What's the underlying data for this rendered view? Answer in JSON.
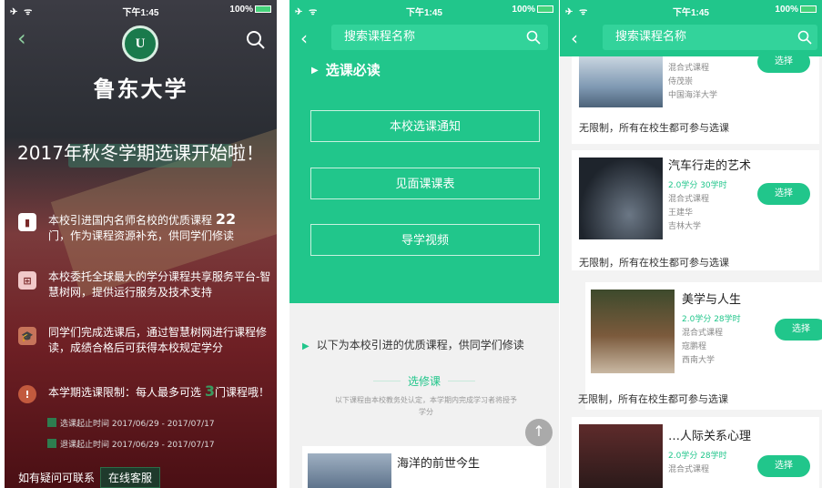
{
  "status": {
    "carrier": "✈ ᯤ",
    "time": "下午1:45",
    "battery": "100%"
  },
  "panel1": {
    "university": "鲁东大学",
    "logo_text": "U",
    "headline": "2017年秋冬学期选课开始啦！",
    "item1_text": "本校引进国内名师名校的优质课程",
    "item1_count": "22",
    "item1_text2": "门，作为课程资源补充，供同学们修读",
    "item2_text": "本校委托全球最大的学分课程共享服务平台-智慧树网，提供运行服务及技术支持",
    "item3_text": "同学们完成选课后，通过智慧树网进行课程修读，成绩合格后可获得本校规定学分",
    "item4_text": "本学期选课限制：每人最多可选",
    "item4_count": "3",
    "item4_text2": "门课程哦！",
    "date1": "选课起止时间 2017/06/29 - 2017/07/17",
    "date2": "退课起止时间 2017/06/29 - 2017/07/17",
    "contact_label": "如有疑问可联系",
    "contact_button": "在线客服"
  },
  "panel2": {
    "search_placeholder": "搜索课程名称",
    "section_title": "选课必读",
    "btn1": "本校选课通知",
    "btn2": "见面课课表",
    "btn3": "导学视频",
    "intro": "以下为本校引进的优质课程，供同学们修读",
    "sub_title": "选修课",
    "sub_desc": "以下课程由本校教务处认定，本学期内完成学习者将授予学分",
    "course_title": "海洋的前世今生"
  },
  "panel3": {
    "search_placeholder": "搜索课程名称",
    "card1": {
      "meta1": "混合式课程",
      "meta2": "侍茂崇",
      "meta3": "中国海洋大学",
      "btn": "选择"
    },
    "restrict1": "无限制，所有在校生都可参与选课",
    "card2": {
      "title": "汽车行走的艺术",
      "credit": "2.0学分",
      "hours": "30学时",
      "type": "混合式课程",
      "teacher": "王建华",
      "school": "吉林大学",
      "btn": "选择"
    },
    "restrict2": "无限制，所有在校生都可参与选课",
    "card3": {
      "title": "美学与人生",
      "credit": "2.0学分",
      "hours": "28学时",
      "type": "混合式课程",
      "teacher": "寇鹏程",
      "school": "西南大学",
      "btn": "选择"
    },
    "restrict3": "无限制，所有在校生都可参与选课",
    "card4": {
      "title": "…人际关系心理",
      "credit": "2.0学分",
      "hours": "28学时",
      "type": "混合式课程",
      "btn": "选择"
    }
  },
  "colors": {
    "accent": "#21c68b",
    "banner_red": "#6f2025"
  }
}
